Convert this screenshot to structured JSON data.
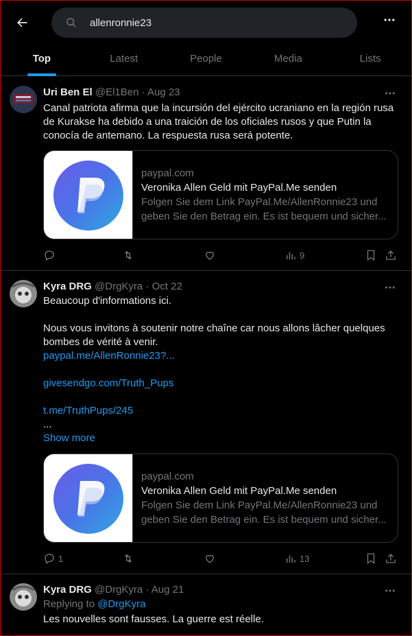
{
  "search": {
    "query": "allenronnie23"
  },
  "tabs": [
    {
      "label": "Top"
    },
    {
      "label": "Latest"
    },
    {
      "label": "People"
    },
    {
      "label": "Media"
    },
    {
      "label": "Lists"
    }
  ],
  "posts": [
    {
      "name": "Uri Ben El",
      "meta": "@El1Ben · Aug 23",
      "text": "Canal patriota afirma que la incursión del ejército ucraniano en la región rusa de Kurakse ha debido a una traición de los oficiales rusos y que Putin la conocía de antemano. La respuesta rusa será potente.",
      "card": {
        "domain": "paypal.com",
        "title": "Veronika Allen Geld mit PayPal.Me senden",
        "desc1": "Folgen Sie dem Link PayPal.Me/AllenRonnie23 und",
        "desc2": "geben Sie den Betrag ein. Es ist bequem und sicher..."
      },
      "replies": "",
      "views": "9"
    },
    {
      "name": "Kyra DRG",
      "meta": "@DrgKyra · Oct 22",
      "line1": "Beaucoup d'informations ici.",
      "line2": "Nous vous invitons à soutenir notre chaîne car nous allons lâcher quelques bombes de vérité à venir.",
      "link1": "paypal.me/AllenRonnie23?...",
      "link2": "givesendgo.com/Truth_Pups",
      "link3": "t.me/TruthPups/245",
      "ellipsis": "...",
      "show_more": "Show more",
      "card": {
        "domain": "paypal.com",
        "title": "Veronika Allen Geld mit PayPal.Me senden",
        "desc1": "Folgen Sie dem Link PayPal.Me/AllenRonnie23 und",
        "desc2": "geben Sie den Betrag ein. Es ist bequem und sicher..."
      },
      "replies": "1",
      "views": "13"
    },
    {
      "name": "Kyra DRG",
      "meta": "@DrgKyra · Aug 21",
      "replying_prefix": "Replying to",
      "replying_to": "@DrgKyra",
      "text": "Les nouvelles sont fausses. La guerre est réelle."
    }
  ],
  "colors": {
    "accent": "#1d9bf0",
    "bg": "#000000",
    "muted": "#71767b",
    "border": "#2f3336"
  }
}
